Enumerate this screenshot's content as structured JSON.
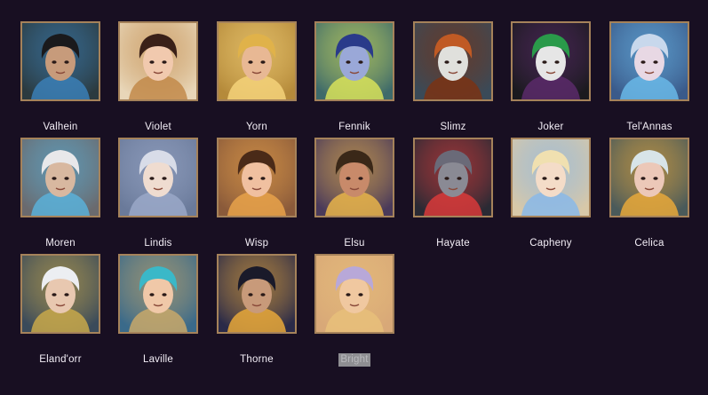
{
  "heroes": [
    {
      "name": "Valhein",
      "bg": "#2b3a3f",
      "hair": "#1a1a1c",
      "skin": "#c79b7b",
      "accent": "#3b7fb6",
      "icon": "valhein-portrait"
    },
    {
      "name": "Violet",
      "bg": "#e8d6b8",
      "hair": "#3a2018",
      "skin": "#f1c9ae",
      "accent": "#c28a4a",
      "icon": "violet-portrait"
    },
    {
      "name": "Yorn",
      "bg": "#b58a3a",
      "hair": "#e0b24a",
      "skin": "#e8b894",
      "accent": "#f4d27a",
      "icon": "yorn-portrait"
    },
    {
      "name": "Fennik",
      "bg": "#3e6a6a",
      "hair": "#2a3a8a",
      "skin": "#9aa8d8",
      "accent": "#d8e25a",
      "icon": "fennik-portrait"
    },
    {
      "name": "Slimz",
      "bg": "#3a4a58",
      "hair": "#c05a24",
      "skin": "#e0e0dc",
      "accent": "#7a3214",
      "icon": "slimz-portrait"
    },
    {
      "name": "Joker",
      "bg": "#1a1a1e",
      "hair": "#2a9a4a",
      "skin": "#e6e6e6",
      "accent": "#5a2a6a",
      "icon": "joker-portrait"
    },
    {
      "name": "Tel'Annas",
      "bg": "#3a5a8a",
      "hair": "#c8d8ec",
      "skin": "#e8d8e4",
      "accent": "#6ab8e8",
      "icon": "telannas-portrait"
    },
    {
      "name": "Moren",
      "bg": "#6a6a6e",
      "hair": "#e8e8ea",
      "skin": "#d8b8a0",
      "accent": "#5ab0d8",
      "icon": "moren-portrait"
    },
    {
      "name": "Lindis",
      "bg": "#6a7a9a",
      "hair": "#d8dce8",
      "skin": "#efdcd0",
      "accent": "#9aa8c8",
      "icon": "lindis-portrait"
    },
    {
      "name": "Wisp",
      "bg": "#8a5a3a",
      "hair": "#4a2a18",
      "skin": "#f0c0a0",
      "accent": "#e8a24a",
      "icon": "wisp-portrait"
    },
    {
      "name": "Elsu",
      "bg": "#4a3a5a",
      "hair": "#3a2818",
      "skin": "#c88a6a",
      "accent": "#e8b44a",
      "icon": "elsu-portrait"
    },
    {
      "name": "Hayate",
      "bg": "#2a2a34",
      "hair": "#6a6a78",
      "skin": "#8a8a94",
      "accent": "#d83a3a",
      "icon": "hayate-portrait"
    },
    {
      "name": "Capheny",
      "bg": "#d8c8a8",
      "hair": "#f0e0b0",
      "skin": "#f4dcc8",
      "accent": "#8ab8e8",
      "icon": "capheny-portrait"
    },
    {
      "name": "Celica",
      "bg": "#4a5a5a",
      "hair": "#d8e4e8",
      "skin": "#ecc8b8",
      "accent": "#e8a83a",
      "icon": "celica-portrait"
    },
    {
      "name": "Eland'orr",
      "bg": "#3a4a5a",
      "hair": "#eceef2",
      "skin": "#e8c8b0",
      "accent": "#c8a84a",
      "icon": "elandorr-portrait"
    },
    {
      "name": "Laville",
      "bg": "#3a6a8a",
      "hair": "#3ab8c8",
      "skin": "#f0c8a8",
      "accent": "#c8a86a",
      "icon": "laville-portrait"
    },
    {
      "name": "Thorne",
      "bg": "#2a2a48",
      "hair": "#1a1a2a",
      "skin": "#c89a7a",
      "accent": "#e8a83a",
      "icon": "thorne-portrait"
    },
    {
      "name": "Bright",
      "bg": "#d8a878",
      "hair": "#b8a8d8",
      "skin": "#f0c8a0",
      "accent": "#e8c07a",
      "icon": "bright-portrait",
      "selected": true
    }
  ]
}
